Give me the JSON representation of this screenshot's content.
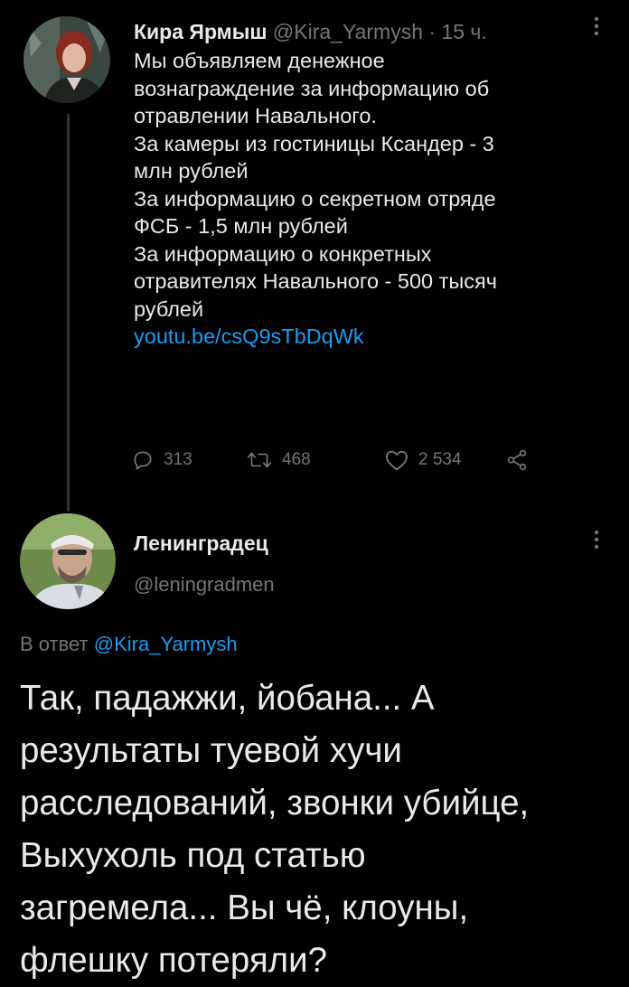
{
  "tweet": {
    "author_name": "Кира Ярмыш",
    "author_handle": "@Kira_Yarmysh",
    "separator": " · ",
    "time": "15 ч.",
    "lines": [
      "Мы объявляем денежное",
      "вознаграждение за информацию об",
      "отравлении Навального.",
      "За камеры из гостиницы Ксандер - 3",
      "млн рублей",
      "За информацию о секретном отряде",
      "ФСБ - 1,5 млн рублей",
      "За информацию о конкретных",
      "отравителях Навального - 500 тысяч",
      "рублей"
    ],
    "link": "youtu.be/csQ9sTbDqWk",
    "replies": "313",
    "retweets": "468",
    "likes": "2 534",
    "icons": {
      "reply": "reply-icon",
      "retweet": "retweet-icon",
      "like": "heart-icon",
      "share": "share-icon",
      "more": "more-vertical-icon"
    }
  },
  "reply": {
    "author_name": "Ленинградец",
    "author_handle": "@leningradmen",
    "reply_prefix": "В ответ ",
    "reply_mention": "@Kira_Yarmysh",
    "lines": [
      "Так, падажжи, йобана... А",
      "результаты туевой хучи",
      "расследований, звонки убийце,",
      "Выхухоль под статью",
      "загремела... Вы чё, клоуны,",
      "флешку потеряли?"
    ]
  },
  "colors": {
    "background": "#000000",
    "text": "#e7e9ea",
    "secondary": "#71767b",
    "link": "#1d9bf0"
  }
}
